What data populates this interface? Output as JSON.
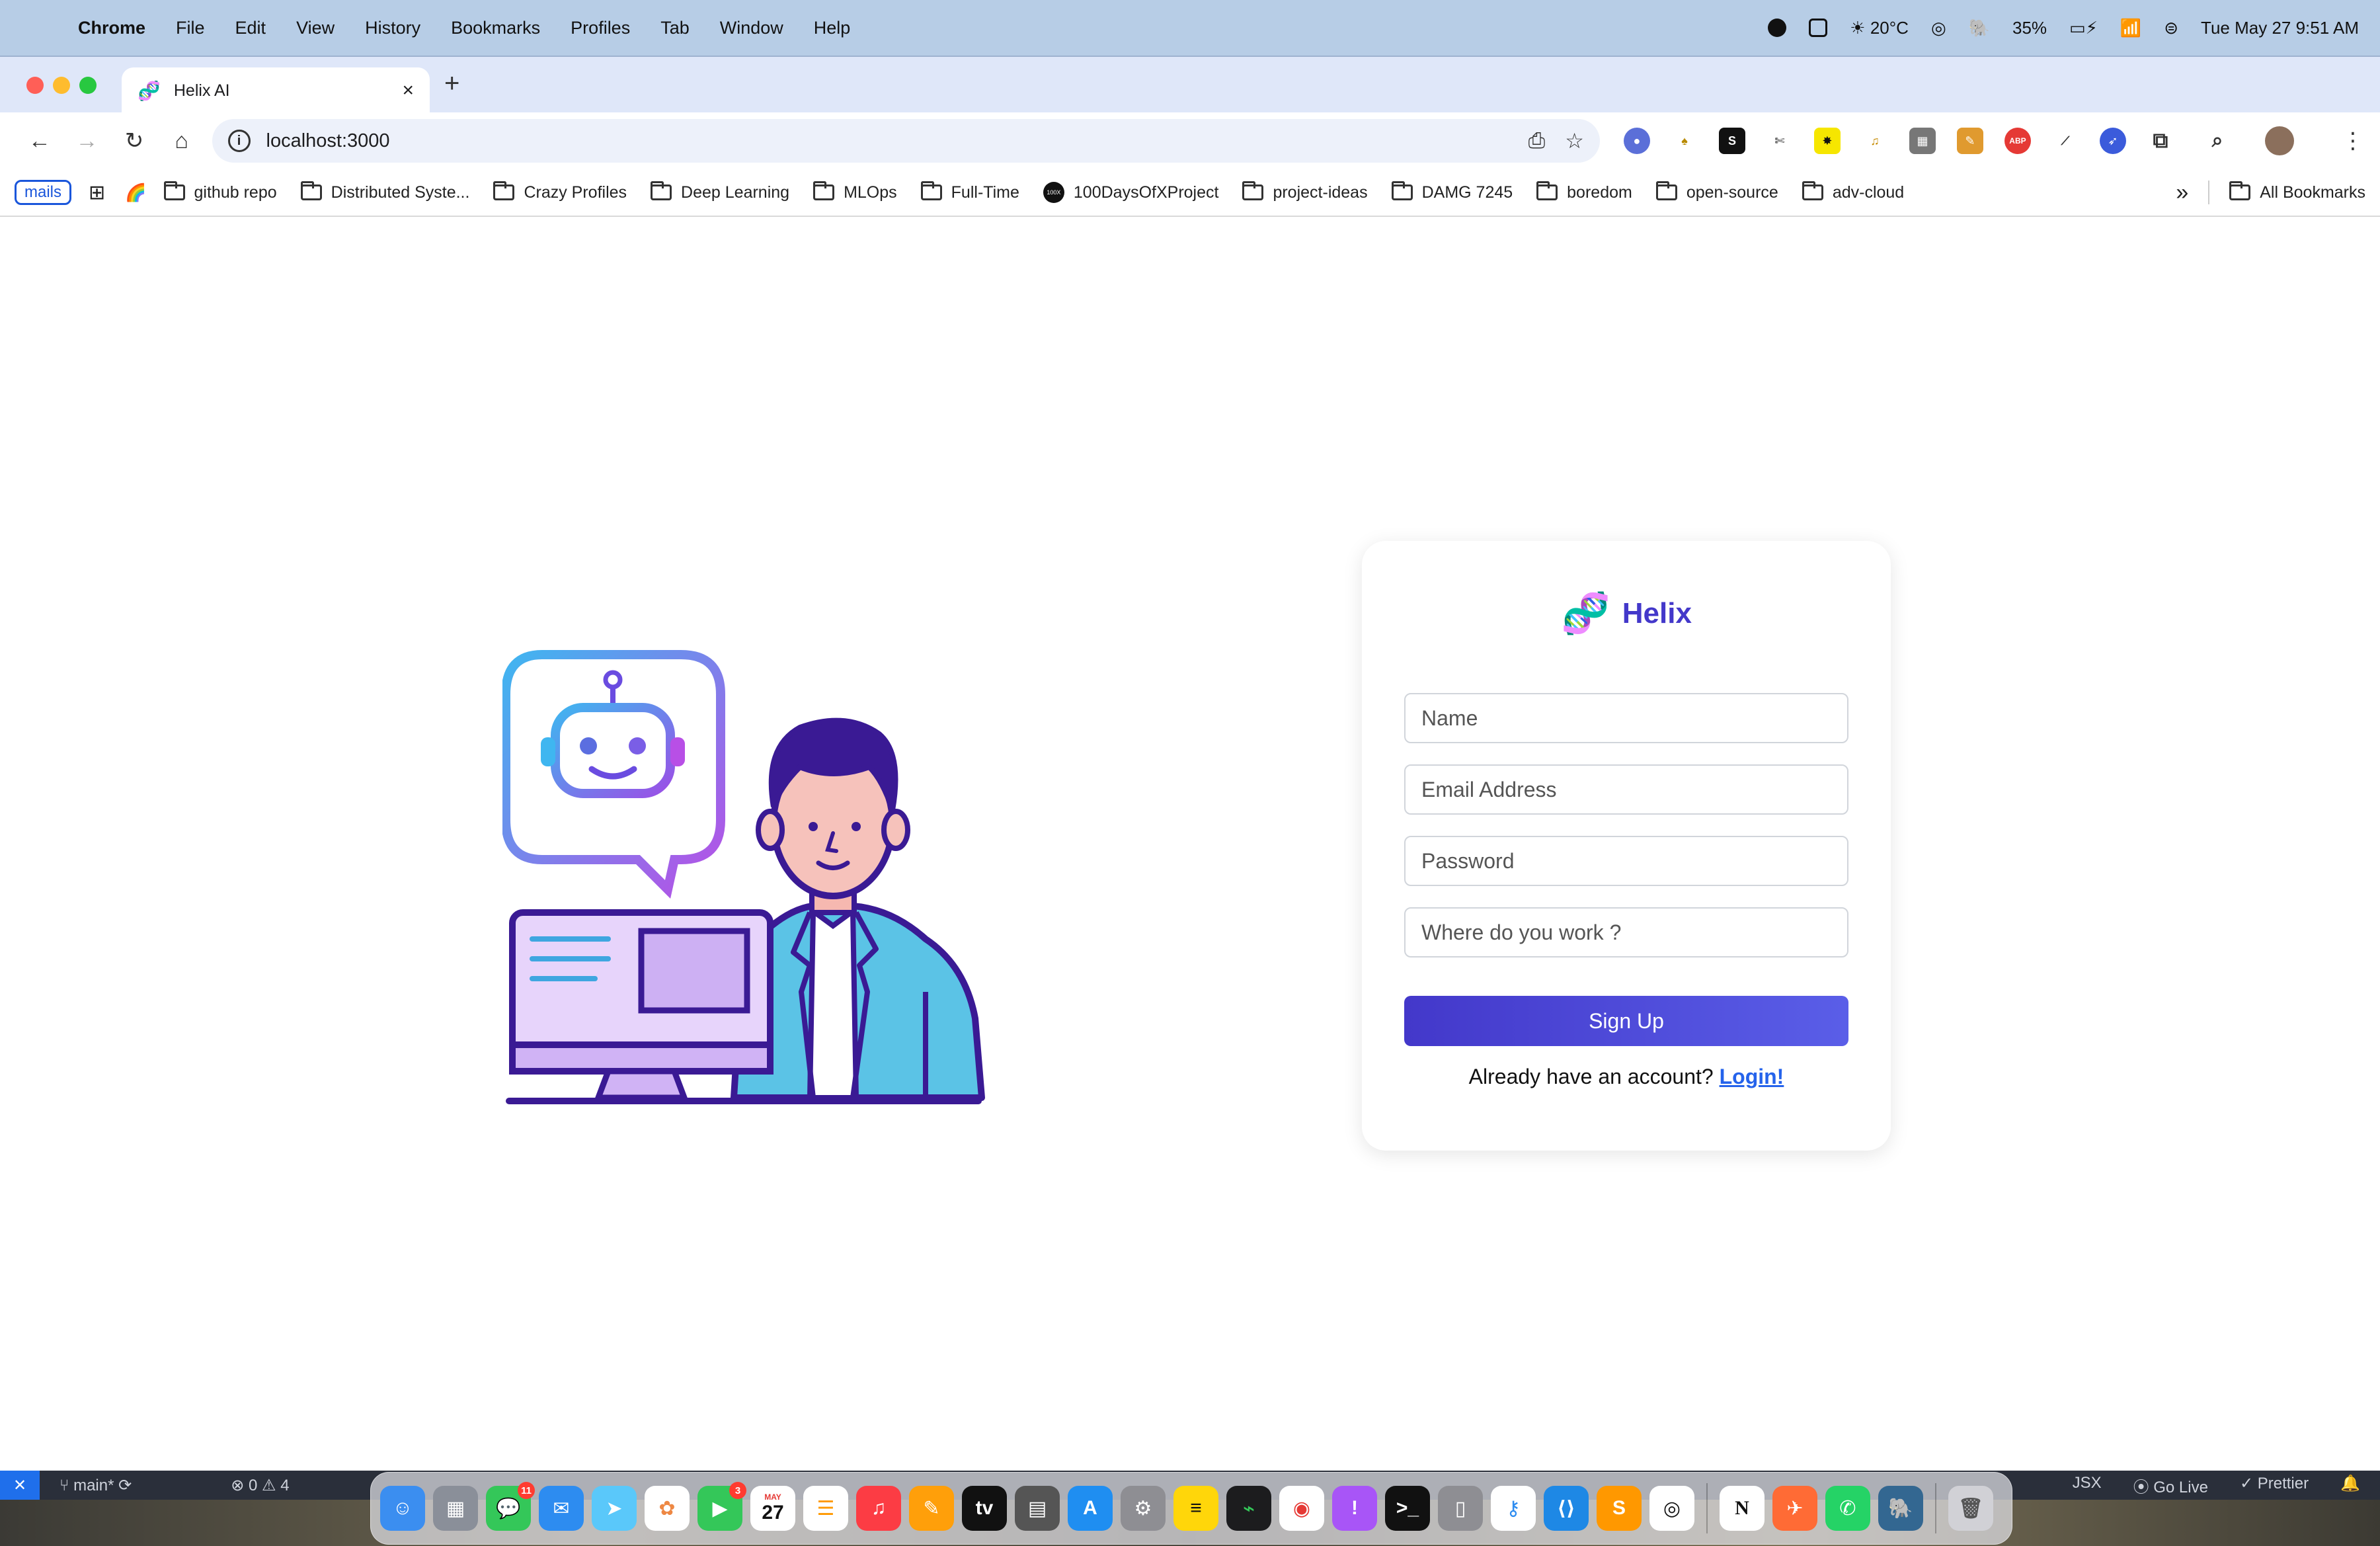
{
  "menubar": {
    "apple_glyph": "",
    "app_name": "Chrome",
    "items": [
      "File",
      "Edit",
      "View",
      "History",
      "Bookmarks",
      "Profiles",
      "Tab",
      "Window",
      "Help"
    ],
    "weather": "☀ 20°C",
    "battery": "35%",
    "datetime": "Tue May 27  9:51 AM"
  },
  "browser": {
    "tab_title": "Helix AI",
    "tab_favicon": "🧬",
    "url": "localhost:3000",
    "bookmarks": {
      "mails_label": "mails",
      "items": [
        {
          "label": "github repo",
          "type": "folder"
        },
        {
          "label": "Distributed Syste...",
          "type": "folder"
        },
        {
          "label": "Crazy Profiles",
          "type": "folder"
        },
        {
          "label": "Deep Learning",
          "type": "folder"
        },
        {
          "label": "MLOps",
          "type": "folder"
        },
        {
          "label": "Full-Time",
          "type": "folder"
        },
        {
          "label": "100DaysOfXProject",
          "type": "site"
        },
        {
          "label": "project-ideas",
          "type": "folder"
        },
        {
          "label": "DAMG 7245",
          "type": "folder"
        },
        {
          "label": "boredom",
          "type": "folder"
        },
        {
          "label": "open-source",
          "type": "folder"
        },
        {
          "label": "adv-cloud",
          "type": "folder"
        }
      ],
      "all_bookmarks_label": "All Bookmarks",
      "overflow": "»"
    }
  },
  "signup": {
    "brand_logo": "🧬",
    "brand_name": "Helix",
    "fields": {
      "name_placeholder": "Name",
      "email_placeholder": "Email Address",
      "password_placeholder": "Password",
      "work_placeholder": "Where do you work ?"
    },
    "submit_label": "Sign Up",
    "login_prompt": "Already have an account?",
    "login_link": "Login!",
    "accent_color": "#4338ca",
    "link_color": "#2563eb"
  },
  "statusbar": {
    "branch": "main*",
    "problems": "⊗ 0 ⚠ 4",
    "language": "JSX",
    "go_live": "Go Live",
    "prettier": "✓ Prettier"
  },
  "dock": {
    "messages_badge": "11",
    "facetime_badge": "3",
    "calendar_month": "MAY",
    "calendar_day": "27"
  }
}
